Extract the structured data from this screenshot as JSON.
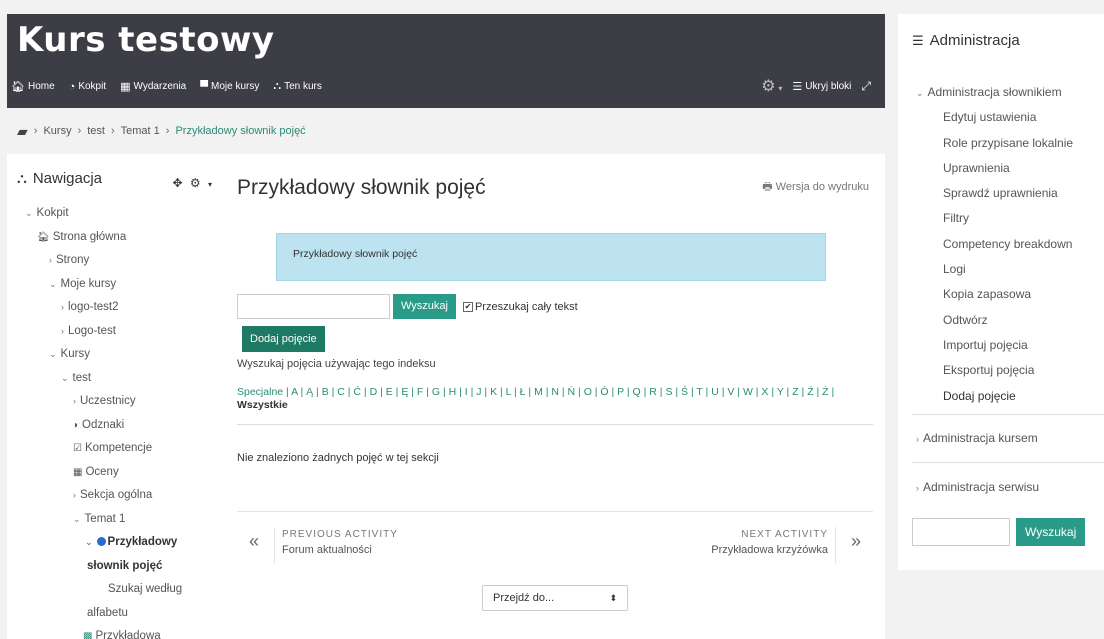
{
  "site": {
    "title": "Kurs testowy",
    "nav": [
      {
        "icon": "home-icon",
        "glyph": "🏠︎",
        "label": "Home"
      },
      {
        "icon": "dashboard-icon",
        "glyph": "◔",
        "label": "Kokpit"
      },
      {
        "icon": "calendar-icon",
        "glyph": "▦",
        "label": "Wydarzenia"
      },
      {
        "icon": "briefcase-icon",
        "glyph": "▀",
        "label": "Moje kursy"
      },
      {
        "icon": "sitemap-icon",
        "glyph": "⛬",
        "label": "Ten kurs"
      }
    ],
    "hide_blocks_label": "Ukryj bloki"
  },
  "breadcrumb": {
    "items": [
      "Kursy",
      "test",
      "Temat 1",
      "Przykładowy słownik pojęć"
    ]
  },
  "navigation": {
    "title": "Nawigacja",
    "items": [
      {
        "label": "Kokpit",
        "arrow": "⌄"
      },
      {
        "label": "Strona główna",
        "icon": "🏠︎"
      },
      {
        "label": "Strony",
        "arrow": "›"
      },
      {
        "label": "Moje kursy",
        "arrow": "⌄"
      },
      {
        "label": "logo-test2",
        "arrow": "›"
      },
      {
        "label": "Logo-test",
        "arrow": "›"
      },
      {
        "label": "Kursy",
        "arrow": "⌄"
      },
      {
        "label": "test",
        "arrow": "⌄"
      },
      {
        "label": "Uczestnicy",
        "arrow": "›"
      },
      {
        "label": "Odznaki",
        "icon": "◗"
      },
      {
        "label": "Kompetencje",
        "icon": "☑"
      },
      {
        "label": "Oceny",
        "icon": "▦"
      },
      {
        "label": "Sekcja ogólna",
        "arrow": "›"
      },
      {
        "label": "Temat 1",
        "arrow": "⌄"
      },
      {
        "label": "Przykładowy",
        "arrow": "⌄"
      },
      {
        "label": "słownik pojęć"
      },
      {
        "label": "Szukaj według"
      },
      {
        "label": "alfabetu"
      },
      {
        "label": "Przykładowa",
        "icon": "▩"
      }
    ]
  },
  "main": {
    "title": "Przykładowy słownik pojęć",
    "print_label": "Wersja do wydruku",
    "intro": "Przykładowy słownik pojęć",
    "search_button": "Wyszukaj",
    "fulltext_label": "Przeszukaj cały tekst",
    "add_button": "Dodaj pojęcie",
    "index_hint": "Wyszukaj pojęcia używając tego indeksu",
    "letters": [
      "Specjalne",
      "A",
      "Ą",
      "B",
      "C",
      "Ć",
      "D",
      "E",
      "Ę",
      "F",
      "G",
      "H",
      "I",
      "J",
      "K",
      "L",
      "Ł",
      "M",
      "N",
      "Ń",
      "O",
      "Ó",
      "P",
      "Q",
      "R",
      "S",
      "Ś",
      "T",
      "U",
      "V",
      "W",
      "X",
      "Y",
      "Z",
      "Ź",
      "Ż"
    ],
    "all_label": "Wszystkie",
    "empty_message": "Nie znaleziono żadnych pojęć w tej sekcji",
    "prev": {
      "label": "PREVIOUS ACTIVITY",
      "name": "Forum aktualności"
    },
    "next": {
      "label": "NEXT ACTIVITY",
      "name": "Przykładowa krzyżówka"
    },
    "jump_label": "Przejdź do..."
  },
  "administration": {
    "title": "Administracja",
    "glossary_group": "Administracja słownikiem",
    "items": [
      "Edytuj ustawienia",
      "Role przypisane lokalnie",
      "Uprawnienia",
      "Sprawdź uprawnienia",
      "Filtry",
      "Competency breakdown",
      "Logi",
      "Kopia zapasowa",
      "Odtwórz",
      "Importuj pojęcia",
      "Eksportuj pojęcia",
      "Dodaj pojęcie"
    ],
    "course_admin": "Administracja kursem",
    "site_admin": "Administracja serwisu",
    "search_button": "Wyszukaj"
  }
}
